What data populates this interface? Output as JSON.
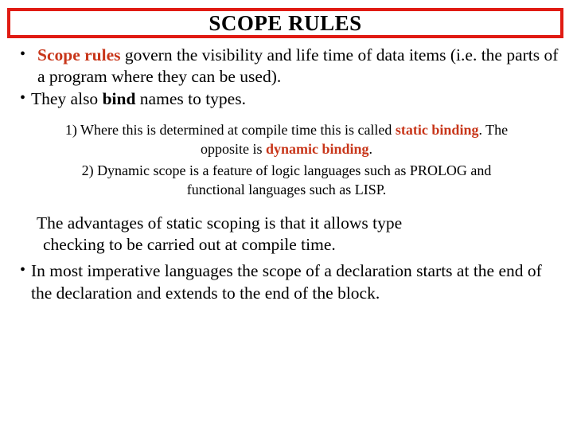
{
  "slide": {
    "title": "SCOPE RULES",
    "accent_color": "#e01b13",
    "highlight_color": "#c8361a",
    "background_color": "#ffffff",
    "text_color": "#000000",
    "bullet_glyph": "•"
  },
  "bullets": [
    {
      "marker": "•",
      "lead_bold_red": "Scope rules",
      "text": " govern the visibility and life time of data items (i.e. the parts of a program where they can be used)."
    },
    {
      "marker": "•",
      "pre": "They also ",
      "bold": "bind",
      "post": " names to types."
    }
  ],
  "numbered": [
    {
      "label": "1)",
      "pre": " Where this is determined at compile time this is called ",
      "red1": "static binding",
      "mid": ". The opposite is ",
      "red2": "dynamic binding",
      "post": "."
    },
    {
      "label": "2)",
      "text": " Dynamic scope is a feature of logic languages such as PROLOG and functional languages such as LISP."
    }
  ],
  "paragraph": {
    "line1": "The advantages of static scoping is that it allows type",
    "line2": "checking to be carried out at compile time."
  },
  "final_bullet": {
    "marker": "•",
    "text": "In most imperative languages the scope of a declaration starts at the end of the declaration and extends to the end of the block."
  }
}
